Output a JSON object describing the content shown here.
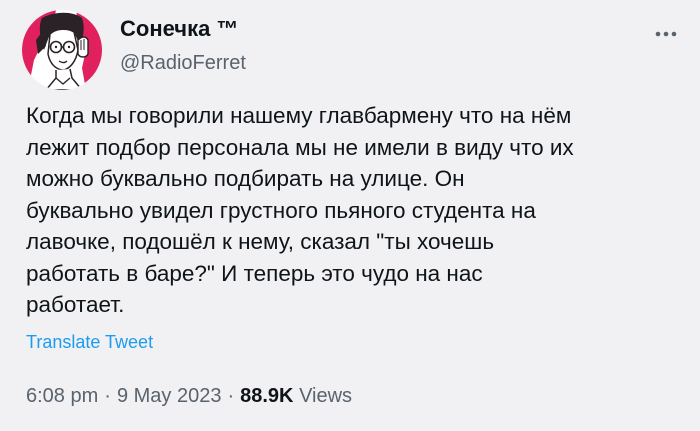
{
  "author": {
    "display_name": "Сонечка ™",
    "handle": "@RadioFerret"
  },
  "more_icon": "ellipsis-icon",
  "tweet": {
    "text": "Когда мы говорили нашему главбармену что на нём\nлежит подбор персонала мы не имели в виду что их\nможно буквально подбирать на улице. Он\nбуквально увидел грустного пьяного студента на\nлавочке, подошёл к нему, сказал \"ты хочешь\nработать в баре?\" И теперь это чудо на нас\nработает.",
    "translate_label": "Translate Tweet"
  },
  "meta": {
    "time": "6:08 pm",
    "separator": "·",
    "date": "9 May 2023",
    "views_count": "88.9K",
    "views_label": "Views"
  },
  "colors": {
    "background": "#f1f1f3",
    "link": "#1d9bf0",
    "secondary_text": "#59636e",
    "avatar_accent": "#e0215d"
  }
}
